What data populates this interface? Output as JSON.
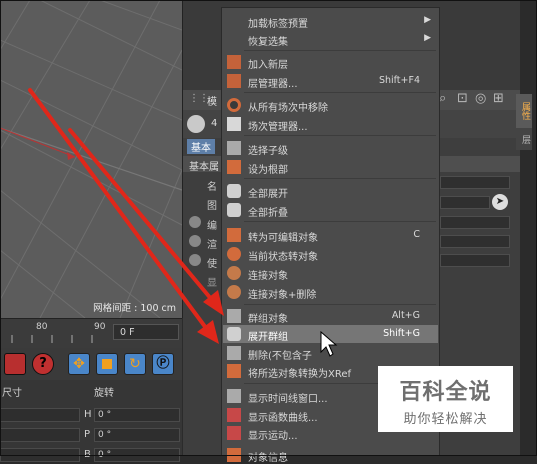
{
  "viewport": {
    "grid_label": "网格间距 : 100 cm"
  },
  "timeline": {
    "ticks": [
      "80",
      "90"
    ],
    "frame_value": "0 F"
  },
  "coordinates": {
    "headers": {
      "size": "尺寸",
      "rotation": "旋转"
    },
    "rows": [
      {
        "axis": "H",
        "value": "0 °"
      },
      {
        "axis": "P",
        "value": "0 °"
      },
      {
        "axis": "B",
        "value": "0 °"
      }
    ]
  },
  "attributes": {
    "tab_mode": "模",
    "count": "4",
    "tab_basic": "基本",
    "section": "基本属",
    "labels": [
      "名",
      "图",
      "编",
      "渲",
      "使",
      "显"
    ],
    "side_tab_1": "属性",
    "side_tab_2": "层"
  },
  "menu": {
    "items": [
      {
        "label": "加载标签预置",
        "shortcut": "",
        "submenu": true,
        "icon": "blank-icon"
      },
      {
        "label": "恢复选集",
        "shortcut": "",
        "submenu": true,
        "icon": "blank-icon"
      },
      {
        "label": "加入新层",
        "shortcut": "",
        "submenu": false,
        "icon": "new-layer-icon"
      },
      {
        "label": "层管理器...",
        "shortcut": "Shift+F4",
        "submenu": false,
        "icon": "layer-manager-icon"
      },
      {
        "label": "从所有场次中移除",
        "shortcut": "",
        "submenu": false,
        "icon": "remove-takes-icon"
      },
      {
        "label": "场次管理器...",
        "shortcut": "",
        "submenu": false,
        "icon": "take-manager-icon"
      },
      {
        "label": "选择子级",
        "shortcut": "",
        "submenu": false,
        "icon": "select-children-icon"
      },
      {
        "label": "设为根部",
        "shortcut": "",
        "submenu": false,
        "icon": "set-root-icon"
      },
      {
        "label": "全部展开",
        "shortcut": "",
        "submenu": false,
        "icon": "expand-all-icon"
      },
      {
        "label": "全部折叠",
        "shortcut": "",
        "submenu": false,
        "icon": "collapse-all-icon"
      },
      {
        "label": "转为可编辑对象",
        "shortcut": "C",
        "submenu": false,
        "icon": "make-editable-icon"
      },
      {
        "label": "当前状态转对象",
        "shortcut": "",
        "submenu": false,
        "icon": "current-state-icon"
      },
      {
        "label": "连接对象",
        "shortcut": "",
        "submenu": false,
        "icon": "connect-icon"
      },
      {
        "label": "连接对象+删除",
        "shortcut": "",
        "submenu": false,
        "icon": "connect-delete-icon"
      },
      {
        "label": "群组对象",
        "shortcut": "Alt+G",
        "submenu": false,
        "icon": "group-icon"
      },
      {
        "label": "展开群组",
        "shortcut": "Shift+G",
        "submenu": false,
        "icon": "expand-group-icon"
      },
      {
        "label": "删除(不包含子",
        "shortcut": "",
        "submenu": false,
        "icon": "delete-icon"
      },
      {
        "label": "将所选对象转换为XRef",
        "shortcut": "",
        "submenu": false,
        "icon": "xref-icon"
      },
      {
        "label": "显示时间线窗口...",
        "shortcut": "",
        "submenu": false,
        "icon": "timeline-icon"
      },
      {
        "label": "显示函数曲线...",
        "shortcut": "",
        "submenu": false,
        "icon": "fcurve-icon"
      },
      {
        "label": "显示运动...",
        "shortcut": "",
        "submenu": false,
        "icon": "motion-icon"
      },
      {
        "label": "对象信息",
        "shortcut": "",
        "submenu": false,
        "icon": "info-icon"
      }
    ],
    "highlighted": "展开群组"
  },
  "watermark": {
    "title": "百科全说",
    "subtitle": "助你轻松解决"
  },
  "colors": {
    "arrow": "#e0271a",
    "menu_bg": "#4b4b4b",
    "highlight": "#767676",
    "accent_tab": "#ffb44b"
  }
}
